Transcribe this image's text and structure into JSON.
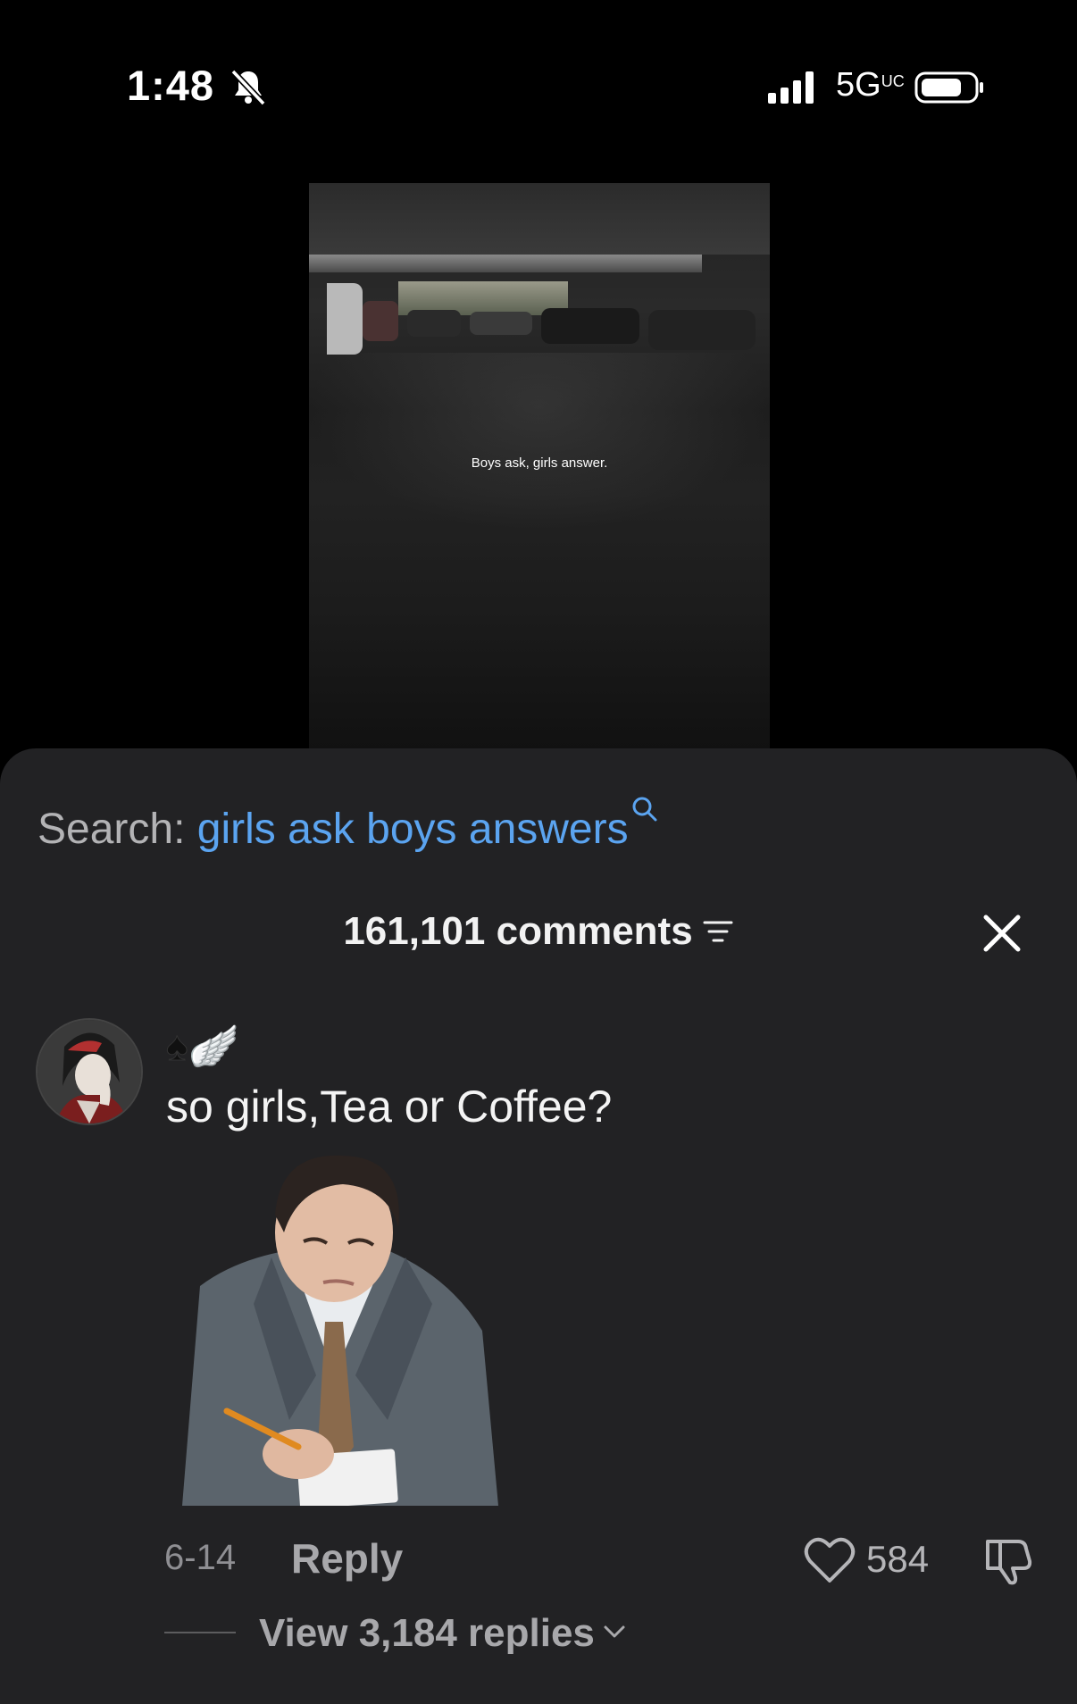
{
  "status_bar": {
    "time": "1:48",
    "network": "5G",
    "network_suffix": "UC"
  },
  "video": {
    "caption": "Boys ask, girls answer."
  },
  "search": {
    "prefix": "Search:",
    "term": "girls ask boys answers"
  },
  "comments": {
    "count_label": "161,101 comments"
  },
  "comment": {
    "username_spade": "♠",
    "username_wing": "🪽",
    "text": "so girls,Tea or Coffee?",
    "date": "6-14",
    "reply_label": "Reply",
    "like_count": "584",
    "view_replies_label": "View 3,184 replies"
  },
  "colors": {
    "sheet_background": "#222224",
    "search_term": "#5ba4f0",
    "secondary_text": "#a8a8ab"
  },
  "icons": [
    "bell-slash-icon",
    "signal-icon",
    "battery-icon",
    "search-icon",
    "filter-icon",
    "close-icon",
    "heart-icon",
    "dislike-icon",
    "chevron-down-icon"
  ]
}
